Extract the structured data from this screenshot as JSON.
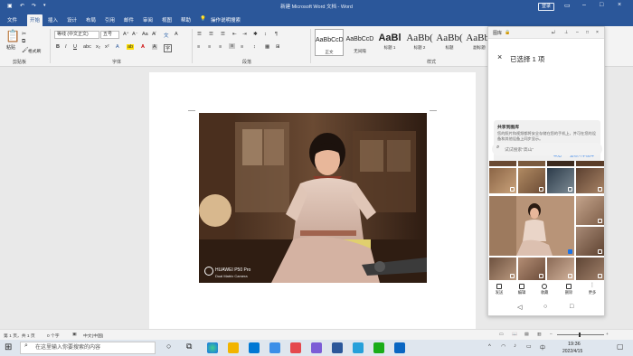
{
  "window": {
    "title": "新建 Microsoft Word 文档 - Word",
    "login_label": "登录",
    "minimize_icon": "minimize-icon",
    "maximize_icon": "maximize-icon",
    "close_icon": "close-icon"
  },
  "quick_access": {
    "save_icon": "save-icon",
    "undo_icon": "undo-icon",
    "redo_icon": "redo-icon"
  },
  "ribbon_tabs": [
    "文件",
    "开始",
    "插入",
    "设计",
    "布局",
    "引用",
    "邮件",
    "审阅",
    "视图",
    "帮助"
  ],
  "tell_me": "操作说明搜索",
  "clipboard": {
    "paste_label": "粘贴",
    "format_painter_label": "格式刷",
    "group_label": "剪贴板"
  },
  "font": {
    "family": "等线 (中文正文)",
    "size": "五号",
    "group_label": "字体",
    "bold": "B",
    "italic": "I",
    "underline": "U",
    "font_color": "A"
  },
  "paragraph": {
    "group_label": "段落"
  },
  "styles": {
    "group_label": "样式",
    "items": [
      {
        "preview": "AaBbCcD",
        "name": "正文"
      },
      {
        "preview": "AaBbCcD",
        "name": "无间隔"
      },
      {
        "preview": "AaBl",
        "name": "标题 1"
      },
      {
        "preview": "AaBb(",
        "name": "标题 2"
      },
      {
        "preview": "AaBb(",
        "name": "标题"
      },
      {
        "preview": "AaBb(",
        "name": "副标题"
      }
    ]
  },
  "photo": {
    "watermark_line1": "HUAWEI P50 Pro",
    "watermark_line2": "Dual Matrix Camera"
  },
  "statusbar": {
    "page": "第 1 页，共 1 页",
    "words": "0 个字",
    "language": "中文(中国)"
  },
  "taskbar": {
    "search_placeholder": "在这里输入你要搜索的内容",
    "time": "19:36",
    "date": "2022/4/15",
    "start_icon": "windows-start-icon"
  },
  "phone": {
    "app_title": "图库",
    "selected_text": "已选择 1 项",
    "notice_title": "共享到图库",
    "notice_body": "您的照片和视频都将安全存储在您的手机上，并可在您的设备和其他设备上同步显示。",
    "notice_ok": "以后",
    "notice_link": "查看共享图库",
    "search_placeholder": "试试搜索\"高山\"",
    "tools": [
      "发送",
      "编辑",
      "收藏",
      "删除",
      "更多"
    ]
  },
  "colors": {
    "word_blue": "#2b579a",
    "ribbon_bg": "#f3f3f3",
    "accent_blue": "#1a73e8"
  }
}
